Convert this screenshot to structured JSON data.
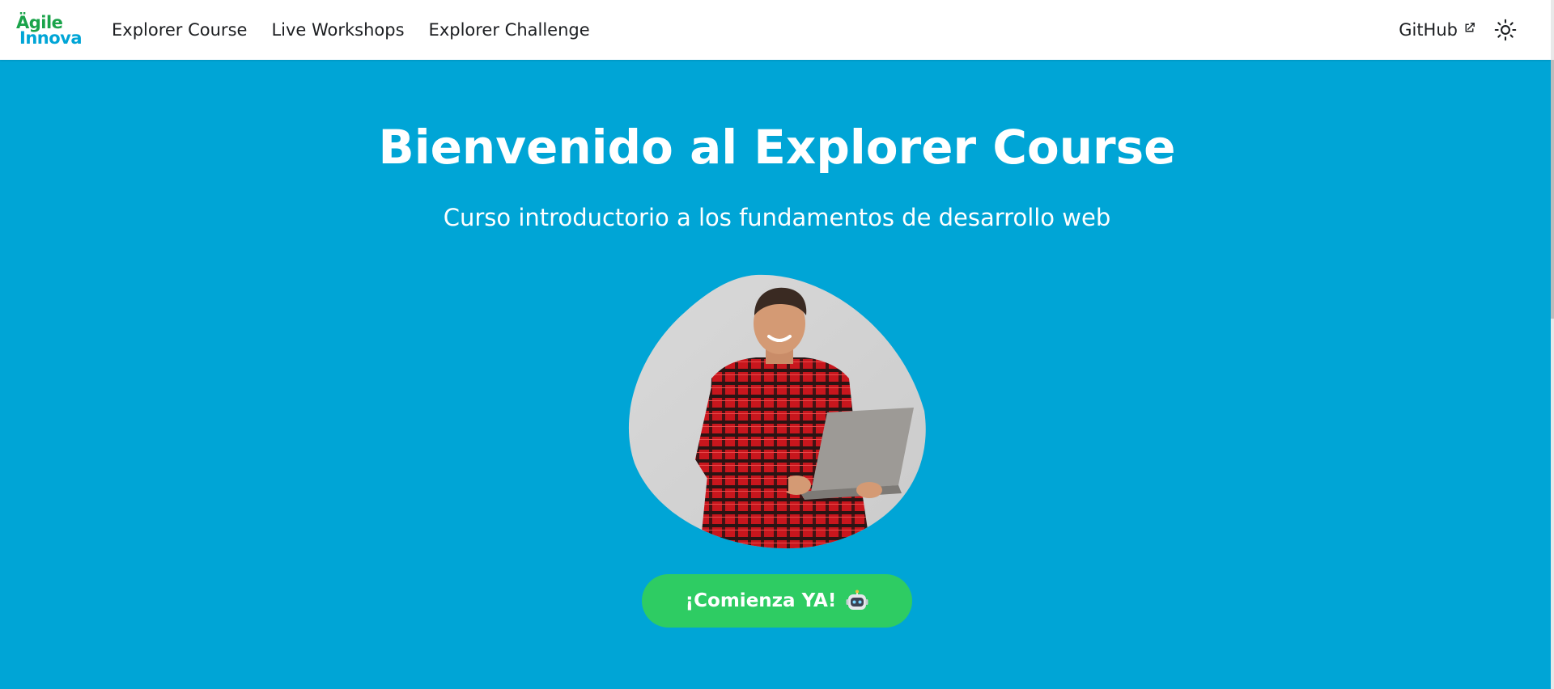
{
  "brand": {
    "logo_line1": "Ägile",
    "logo_line2": "Innova",
    "colors": {
      "green": "#1aa34a",
      "orange": "#f26522",
      "blue": "#00a5d6"
    }
  },
  "nav": {
    "links": [
      {
        "label": "Explorer Course"
      },
      {
        "label": "Live Workshops"
      },
      {
        "label": "Explorer Challenge"
      }
    ],
    "github_label": "GitHub",
    "github_icon": "external-link-icon",
    "theme_icon": "sun-icon"
  },
  "hero": {
    "title": "Bienvenido al Explorer Course",
    "subtitle": "Curso introductorio a los fundamentos de desarrollo web",
    "image_subject": "smiling man in red plaid shirt holding laptop",
    "cta_label": "¡Comienza YA!",
    "cta_icon": "robot-icon"
  },
  "colors": {
    "hero_background": "#00a5d6",
    "cta_background": "#2ecc63",
    "nav_background": "#ffffff",
    "nav_text": "#1c1e21"
  }
}
